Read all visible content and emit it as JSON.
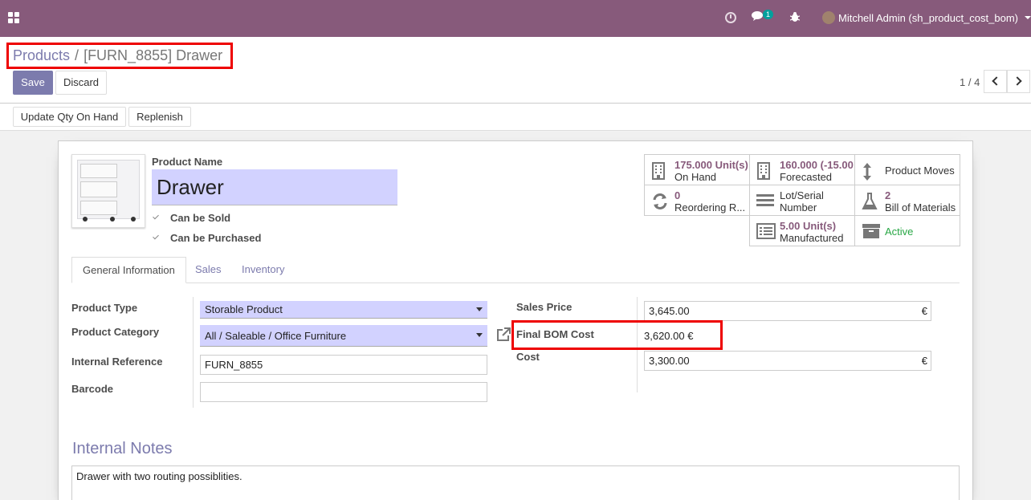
{
  "navbar": {
    "chat_badge": "1",
    "user_name": "Mitchell Admin (sh_product_cost_bom)",
    "icons": [
      "apps-icon",
      "clock-icon",
      "chat-icon",
      "bug-icon",
      "avatar"
    ]
  },
  "breadcrumb": {
    "parent": "Products",
    "separator": "/",
    "current": "[FURN_8855] Drawer"
  },
  "toolbar": {
    "save_label": "Save",
    "discard_label": "Discard",
    "pager": "1 / 4"
  },
  "statusbar": {
    "update_qty_label": "Update Qty On Hand",
    "replenish_label": "Replenish"
  },
  "product": {
    "name_label": "Product Name",
    "name": "Drawer",
    "can_be_sold": "Can be Sold",
    "can_be_purchased": "Can be Purchased"
  },
  "smart_buttons": {
    "on_hand_value": "175.000",
    "on_hand_unit": "Unit(s)",
    "on_hand_label": "On Hand",
    "forecasted_value": "160.000",
    "forecasted_extra": "(-15.00",
    "forecasted_label": "Forecasted",
    "product_moves": "Product Moves",
    "reordering_value": "0",
    "reordering_label": "Reordering R...",
    "lot_serial_line1": "Lot/Serial",
    "lot_serial_line2": "Number",
    "bom_value": "2",
    "bom_label": "Bill of Materials",
    "manufactured_value": "5.00",
    "manufactured_unit": "Unit(s)",
    "manufactured_label": "Manufactured",
    "active_label": "Active"
  },
  "tabs": [
    "General Information",
    "Sales",
    "Inventory"
  ],
  "general": {
    "product_type_label": "Product Type",
    "product_type": "Storable Product",
    "product_category_label": "Product Category",
    "product_category": "All / Saleable / Office Furniture",
    "internal_ref_label": "Internal Reference",
    "internal_ref": "FURN_8855",
    "barcode_label": "Barcode",
    "barcode": "",
    "sales_price_label": "Sales Price",
    "sales_price": "3,645.00",
    "final_bom_label": "Final BOM Cost",
    "final_bom": "3,620.00 €",
    "cost_label": "Cost",
    "cost": "3,300.00",
    "currency": "€"
  },
  "notes": {
    "title": "Internal Notes",
    "text": "Drawer with two routing possiblities."
  },
  "colors": {
    "brand": "#875a7b",
    "primary": "#7c7bad",
    "highlight": "#e00000",
    "required_field": "#d2d2ff"
  }
}
